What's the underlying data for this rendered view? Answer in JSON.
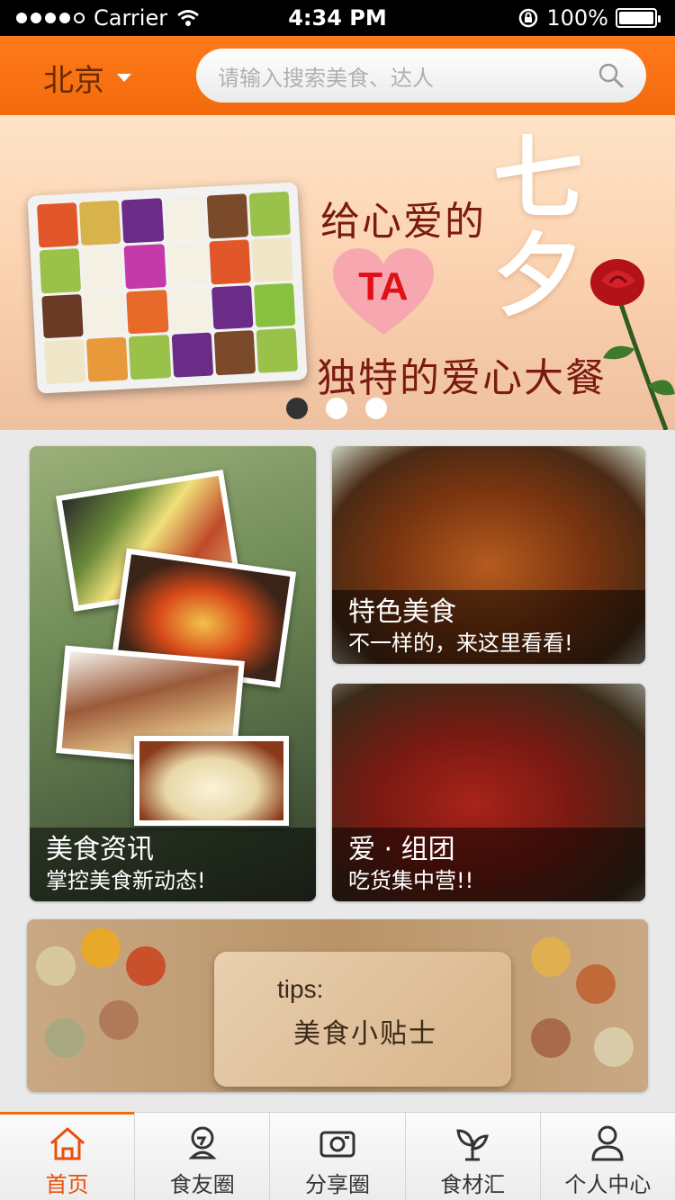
{
  "status_bar": {
    "carrier": "Carrier",
    "time": "4:34 PM",
    "battery": "100%"
  },
  "header": {
    "city": "北京",
    "search_placeholder": "请输入搜索美食、达人"
  },
  "banner": {
    "line1": "给心爱的",
    "heart_text": "TA",
    "line2": "独特的爱心大餐",
    "festival": "七夕",
    "page_count": 3,
    "active_page": 1
  },
  "cards": {
    "news": {
      "title": "美食资讯",
      "subtitle": "掌控美食新动态!"
    },
    "feature": {
      "title": "特色美食",
      "subtitle": "不一样的，来这里看看!"
    },
    "group": {
      "title": "爱 · 组团",
      "subtitle": "吃货集中营!!"
    }
  },
  "tips": {
    "label": "tips:",
    "title": "美食小贴士"
  },
  "tabbar": {
    "items": [
      {
        "label": "首页",
        "icon": "home-icon",
        "active": true
      },
      {
        "label": "食友圈",
        "icon": "chef-icon",
        "active": false
      },
      {
        "label": "分享圈",
        "icon": "camera-icon",
        "active": false
      },
      {
        "label": "食材汇",
        "icon": "sprout-icon",
        "active": false
      },
      {
        "label": "个人中心",
        "icon": "person-icon",
        "active": false
      }
    ]
  },
  "colors": {
    "accent": "#f26a0c",
    "active_tab": "#e8500c"
  }
}
